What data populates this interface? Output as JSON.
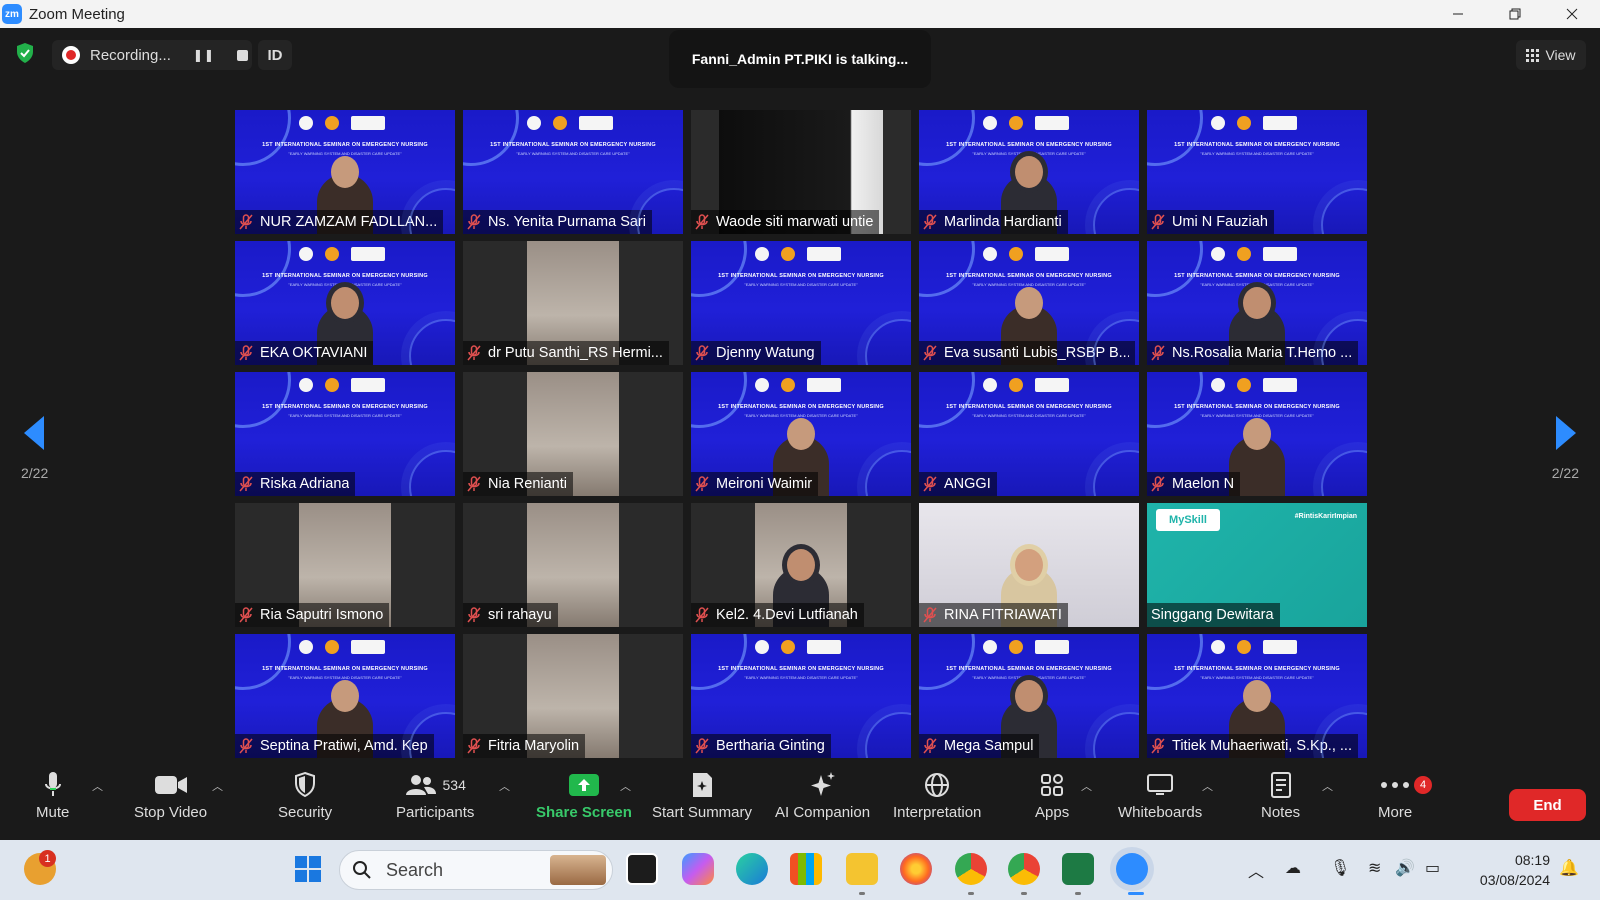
{
  "window": {
    "title": "Zoom Meeting",
    "logo_text": "zm"
  },
  "meeting": {
    "recording_label": "Recording...",
    "pause_symbol": "❚❚",
    "id_label": "ID",
    "talking_text": "Fanni_Admin PT.PIKI is talking...",
    "view_label": "View",
    "page_indicator": "2/22",
    "slide_title": "1ST INTERNATIONAL SEMINAR ON EMERGENCY NURSING",
    "slide_subtitle": "\"EARLY WARNING SYSTEM AND DISASTER CARE UPDATE\"",
    "teal_logo": "MySkill",
    "teal_tag": "#RintisKarirImpian",
    "participants": [
      {
        "name": "NUR ZAMZAM FADLLAN...",
        "muted": true,
        "bg": "slide"
      },
      {
        "name": "Ns. Yenita Purnama Sari",
        "muted": true,
        "bg": "slide"
      },
      {
        "name": "Waode siti marwati untie",
        "muted": true,
        "bg": "black"
      },
      {
        "name": "Marlinda Hardianti",
        "muted": true,
        "bg": "slide"
      },
      {
        "name": "Umi N Fauziah",
        "muted": true,
        "bg": "slide"
      },
      {
        "name": "EKA OKTAVIANI",
        "muted": true,
        "bg": "slide"
      },
      {
        "name": "dr Putu Santhi_RS Hermi...",
        "muted": true,
        "bg": "dark"
      },
      {
        "name": "Djenny Watung",
        "muted": true,
        "bg": "slide"
      },
      {
        "name": "Eva susanti Lubis_RSBP B...",
        "muted": true,
        "bg": "slide"
      },
      {
        "name": "Ns.Rosalia Maria T.Hemo ...",
        "muted": true,
        "bg": "slide"
      },
      {
        "name": "Riska Adriana",
        "muted": true,
        "bg": "slide"
      },
      {
        "name": "Nia Renianti",
        "muted": true,
        "bg": "dark"
      },
      {
        "name": "Meironi Waimir",
        "muted": true,
        "bg": "slide"
      },
      {
        "name": "ANGGI",
        "muted": true,
        "bg": "slide"
      },
      {
        "name": "Maelon  N",
        "muted": true,
        "bg": "slide"
      },
      {
        "name": "Ria Saputri Ismono",
        "muted": true,
        "bg": "dark"
      },
      {
        "name": "sri rahayu",
        "muted": true,
        "bg": "dark"
      },
      {
        "name": "Kel2. 4.Devi Lutfianah",
        "muted": true,
        "bg": "dark"
      },
      {
        "name": "RINA FITRIAWATI",
        "muted": true,
        "bg": "photo"
      },
      {
        "name": "Singgang Dewitara",
        "muted": false,
        "bg": "teal"
      },
      {
        "name": "Septina Pratiwi, Amd. Kep",
        "muted": true,
        "bg": "slide"
      },
      {
        "name": "Fitria Maryolin",
        "muted": true,
        "bg": "dark"
      },
      {
        "name": "Bertharia Ginting",
        "muted": true,
        "bg": "slide"
      },
      {
        "name": "Mega Sampul",
        "muted": true,
        "bg": "slide"
      },
      {
        "name": "Titiek Muhaeriwati, S.Kp., ...",
        "muted": true,
        "bg": "slide"
      }
    ]
  },
  "toolbar": {
    "mute": "Mute",
    "stop_video": "Stop Video",
    "security": "Security",
    "participants": "Participants",
    "participants_count": "534",
    "share_screen": "Share Screen",
    "start_summary": "Start Summary",
    "ai_companion": "AI Companion",
    "interpretation": "Interpretation",
    "apps": "Apps",
    "whiteboards": "Whiteboards",
    "notes": "Notes",
    "more": "More",
    "more_badge": "4",
    "end": "End"
  },
  "taskbar": {
    "search_placeholder": "Search",
    "time": "08:19",
    "date": "03/08/2024",
    "notification_count": "1"
  },
  "colors": {
    "accent": "#2d8cff",
    "share_green": "#21b84c",
    "end_red": "#e02828",
    "slide_blue": "#2020d8",
    "mic_muted": "#e05050"
  }
}
